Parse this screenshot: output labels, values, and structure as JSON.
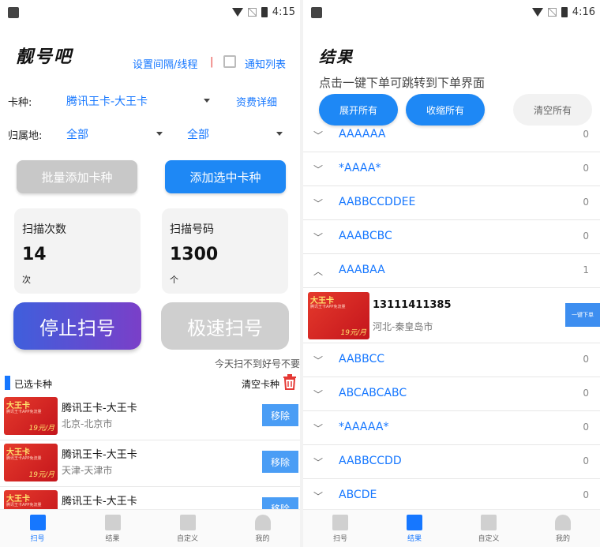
{
  "status_left": {
    "time": "4:15"
  },
  "status_right": {
    "time": "4:16"
  },
  "left": {
    "app_title": "靓号吧",
    "settings_link": "设置间隔/线程",
    "separator": "|",
    "notify_link": "通知列表",
    "card_type": {
      "label": "卡种:",
      "value": "腾讯王卡-大王卡",
      "tariff_link": "资费详细"
    },
    "region": {
      "label": "归属地:",
      "province": "全部",
      "city": "全部"
    },
    "batch_add_button": "批量添加卡种",
    "add_selected_button": "添加选中卡种",
    "scan_count": {
      "title": "扫描次数",
      "value": "14",
      "unit": "次"
    },
    "scan_numbers": {
      "title": "扫描号码",
      "value": "1300",
      "unit": "个"
    },
    "stop_button": "停止扫号",
    "fast_button": "极速扫号",
    "notice": "今天扫不到好号不要走",
    "selected_title": "已选卡种",
    "clear_label": "清空卡种",
    "selected_items": [
      {
        "name": "腾讯王卡-大王卡",
        "location": "北京-北京市",
        "action": "移除"
      },
      {
        "name": "腾讯王卡-大王卡",
        "location": "天津-天津市",
        "action": "移除"
      },
      {
        "name": "腾讯王卡-大王卡",
        "location": "",
        "action": "移除"
      }
    ],
    "card_image": {
      "title": "大王卡",
      "sub": "腾讯王卡APP免流量",
      "price": "19元/月"
    }
  },
  "right": {
    "title": "结果",
    "hint": "点击一键下单可跳转到下单界面",
    "expand_all": "展开所有",
    "collapse_all": "收缩所有",
    "clear_all": "清空所有",
    "groups": [
      {
        "name": "AAAAAA",
        "count": "0",
        "expanded": false
      },
      {
        "name": "*AAAA*",
        "count": "0",
        "expanded": false
      },
      {
        "name": "AABBCCDDEE",
        "count": "0",
        "expanded": false
      },
      {
        "name": "AAABCBC",
        "count": "0",
        "expanded": false
      },
      {
        "name": "AAABAA",
        "count": "1",
        "expanded": true
      },
      {
        "name": "AABBCC",
        "count": "0",
        "expanded": false
      },
      {
        "name": "ABCABCABC",
        "count": "0",
        "expanded": false
      },
      {
        "name": "*AAAAA*",
        "count": "0",
        "expanded": false
      },
      {
        "name": "AABBCCDD",
        "count": "0",
        "expanded": false
      },
      {
        "name": "ABCDE",
        "count": "0",
        "expanded": false
      }
    ],
    "result": {
      "number": "13111411385",
      "location": "河北-秦皇岛市",
      "action": "一键下单"
    }
  },
  "nav": [
    {
      "label": "扫号",
      "icon": "scan-icon"
    },
    {
      "label": "结果",
      "icon": "result-icon"
    },
    {
      "label": "自定义",
      "icon": "edit-icon"
    },
    {
      "label": "我的",
      "icon": "user-icon"
    }
  ],
  "colors": {
    "accent": "#1677ff",
    "button_blue": "#1e88f5",
    "danger": "#e53935",
    "card_red": "#d62a22"
  }
}
